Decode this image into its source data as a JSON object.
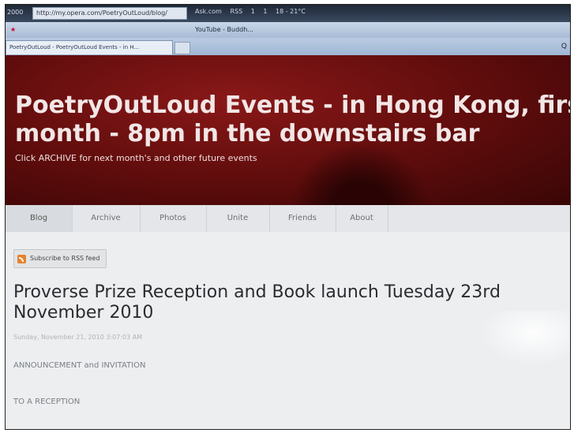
{
  "browser": {
    "address_prefix": "2000",
    "address": "http://my.opera.com/PoetryOutLoud/blog/",
    "toolbar_items": [
      "Ask.com",
      "RSS",
      "1",
      "1",
      "18 - 21°C"
    ],
    "favorites": [
      "YouTube - Buddh..."
    ],
    "tab_label": "PoetryOutLoud - PoetryOutLoud Events - in H..."
  },
  "header": {
    "title_line1": "PoetryOutLoud Events - in Hong Kong, first Wed",
    "title_line2": "month - 8pm in the downstairs bar",
    "subtitle": "Click ARCHIVE for next month's and other future events"
  },
  "nav": {
    "items": [
      {
        "label": "Blog"
      },
      {
        "label": "Archive"
      },
      {
        "label": "Photos"
      },
      {
        "label": "Unite"
      },
      {
        "label": "Friends"
      },
      {
        "label": "About"
      }
    ]
  },
  "rss": {
    "label": "Subscribe to RSS feed"
  },
  "post": {
    "title": "Proverse Prize Reception and Book launch Tuesday 23rd November 2010",
    "date": "Sunday, November 21, 2010 3:07:03 AM",
    "line1": "ANNOUNCEMENT and INVITATION",
    "line2": "TO A RECEPTION"
  }
}
